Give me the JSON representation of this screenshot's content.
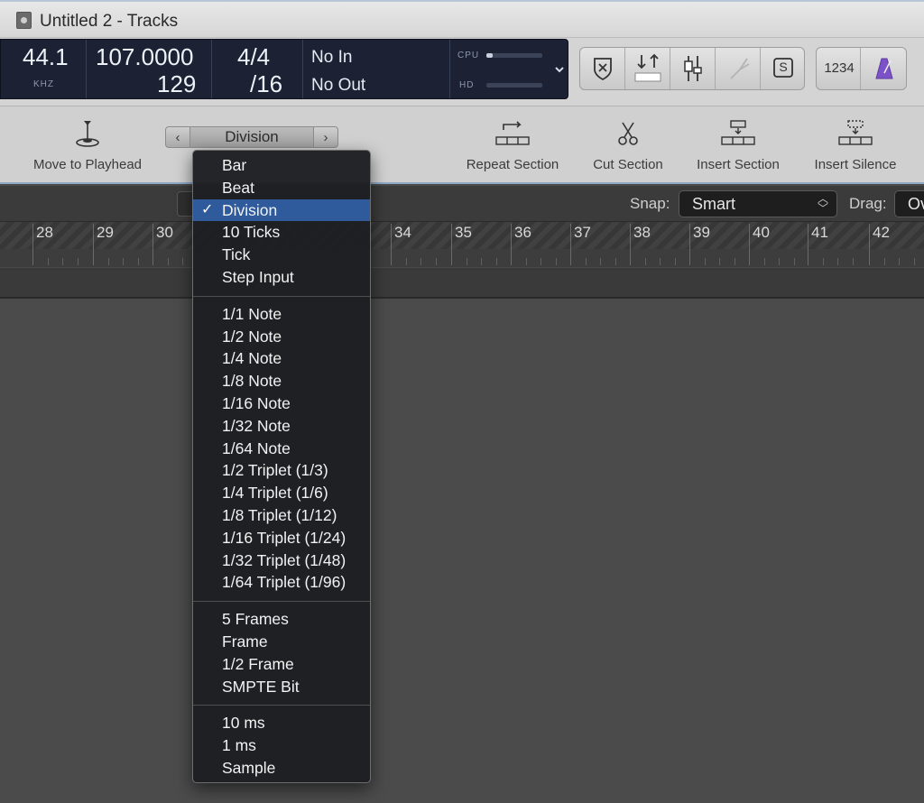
{
  "window": {
    "title": "Untitled 2 - Tracks"
  },
  "lcd": {
    "sample_rate": "44.1",
    "sample_rate_unit": "KHZ",
    "tempo": "107.0000",
    "tempo_sub": "129",
    "signature_top": "4/4",
    "signature_bottom": "/16",
    "midi_in": "No In",
    "midi_out": "No Out",
    "cpu_label": "CPU",
    "hd_label": "HD",
    "cpu_load": 0.12,
    "hd_load": 0.0
  },
  "toolbar": {
    "move_to_playhead": "Move to Playhead",
    "division_value": "Division",
    "repeat_section": "Repeat Section",
    "cut_section": "Cut Section",
    "insert_section": "Insert Section",
    "insert_silence": "Insert Silence"
  },
  "control_buttons": {
    "count_in_label": "1234",
    "solo_label": "S"
  },
  "snapbar": {
    "snap_label": "Snap:",
    "snap_value": "Smart",
    "drag_label": "Drag:",
    "drag_value": "Overlap"
  },
  "ruler": {
    "bars": [
      "28",
      "29",
      "30",
      "34",
      "35",
      "36",
      "37",
      "38",
      "39",
      "40",
      "41",
      "42"
    ]
  },
  "menu": {
    "groups": [
      [
        "Bar",
        "Beat",
        "Division",
        "10 Ticks",
        "Tick",
        "Step Input"
      ],
      [
        "1/1 Note",
        "1/2 Note",
        "1/4 Note",
        "1/8 Note",
        "1/16 Note",
        "1/32 Note",
        "1/64 Note",
        "1/2 Triplet (1/3)",
        "1/4 Triplet (1/6)",
        "1/8 Triplet (1/12)",
        "1/16 Triplet (1/24)",
        "1/32 Triplet (1/48)",
        "1/64 Triplet (1/96)"
      ],
      [
        "5 Frames",
        "Frame",
        "1/2 Frame",
        "SMPTE Bit"
      ],
      [
        "10 ms",
        "1 ms",
        "Sample"
      ]
    ],
    "selected": "Division",
    "check_mark": "✓"
  }
}
